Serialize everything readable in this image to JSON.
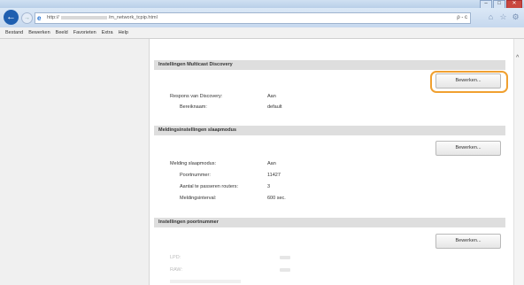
{
  "browser": {
    "address": "http://",
    "address_path": "/m_network_tcpip.html",
    "address_controls": "ρ - c",
    "back_glyph": "←",
    "forward_glyph": "→"
  },
  "menu": [
    "Bestand",
    "Bewerken",
    "Beeld",
    "Favorieten",
    "Extra",
    "Help"
  ],
  "sections": {
    "multicast": {
      "title": "Instellingen Multicast Discovery",
      "edit_label": "Bewerken...",
      "rows": [
        {
          "label": "Respons van Discovery:",
          "value": "Aan"
        },
        {
          "label": "Bereiknaam:",
          "value": "default"
        }
      ]
    },
    "sleep": {
      "title": "Meldingsinstellingen slaapmodus",
      "edit_label": "Bewerken...",
      "rows": [
        {
          "label": "Melding slaapmodus:",
          "value": "Aan"
        },
        {
          "label": "Poortnummer:",
          "value": "11427"
        },
        {
          "label": "Aantal te passeren routers:",
          "value": "3"
        },
        {
          "label": "Meldingsinterval:",
          "value": "600 sec."
        }
      ]
    },
    "ports": {
      "title": "Instellingen poortnummer",
      "edit_label": "Bewerken...",
      "rows": [
        {
          "label": "LPD:"
        },
        {
          "label": "RAW:"
        }
      ]
    }
  }
}
